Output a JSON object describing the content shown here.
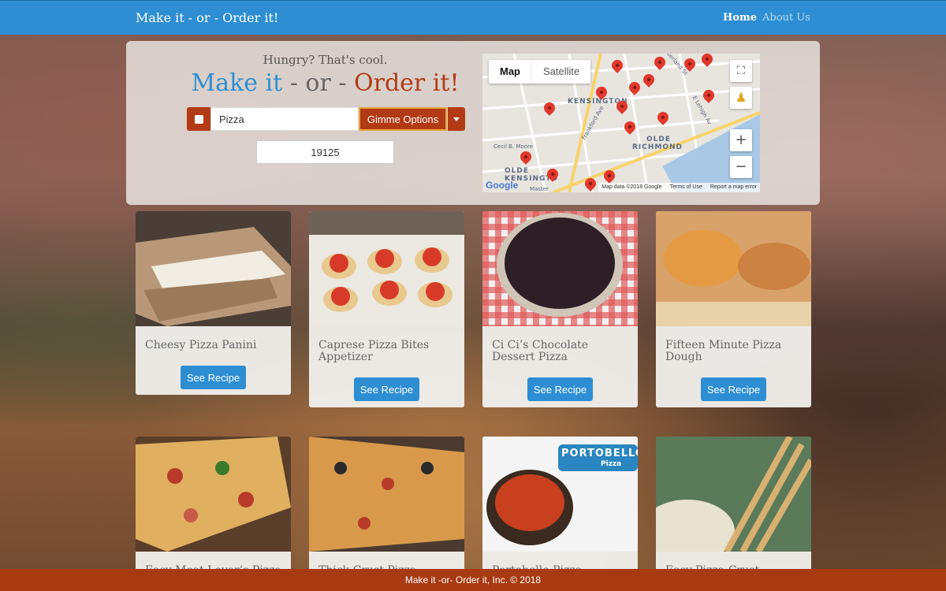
{
  "navbar": {
    "brand": "Make it - or - Order it!",
    "links": [
      "Home",
      "About Us"
    ]
  },
  "hero": {
    "tagline": "Hungry? That's cool.",
    "title_make": "Make it",
    "title_sep": " - or - ",
    "title_order": "Order it!",
    "search_value": "Pizza",
    "gimme_label": "Gimme Options",
    "zip_value": "19125"
  },
  "map": {
    "tab_map": "Map",
    "tab_satellite": "Satellite",
    "labels": [
      "KENSINGTON",
      "OLDE",
      "RICHMOND",
      "OLDE",
      "KENSINGTO"
    ],
    "streets": [
      "Frankford Ave",
      "Cecil B. Moore",
      "E Lehigh Av",
      "E Cumberland St",
      "Master"
    ],
    "google": "Google",
    "footer": [
      "Map data ©2018 Google",
      "Terms of Use",
      "Report a map error"
    ]
  },
  "cards_row1": [
    {
      "title": "Cheesy Pizza Panini",
      "button": "See Recipe"
    },
    {
      "title": "Caprese Pizza Bites Appetizer",
      "button": "See Recipe"
    },
    {
      "title": "Ci Ci’s Chocolate Dessert Pizza",
      "button": "See Recipe"
    },
    {
      "title": "Fifteen Minute Pizza Dough",
      "button": "See Recipe"
    }
  ],
  "cards_row2": [
    {
      "title": "Easy Meat Lover’s Pizza"
    },
    {
      "title": "Thick-Crust Pizza"
    },
    {
      "title": "Portobello Pizza",
      "image_text": "PORTOBELLO",
      "image_subtext": "Pizza"
    },
    {
      "title": "Easy Pizza-Crust"
    }
  ],
  "footer": "Make it -or- Order it, Inc. © 2018",
  "colors": {
    "brand_blue": "#2e8ed3",
    "brand_red": "#b23a15",
    "footer_red": "#a83a12"
  }
}
